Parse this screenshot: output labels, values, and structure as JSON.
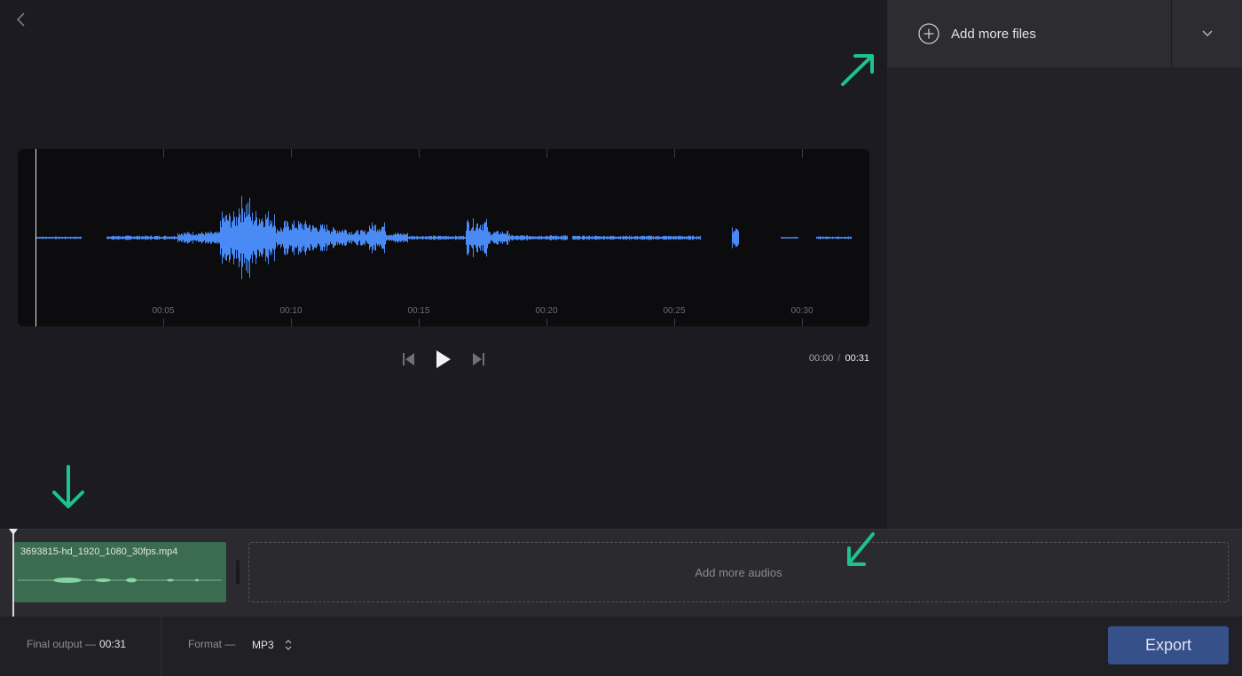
{
  "header": {
    "back_icon": "chevron-left-icon"
  },
  "files_panel": {
    "add_files_label": "Add more files",
    "add_icon": "plus-circle-icon",
    "dropdown_icon": "chevron-down-icon"
  },
  "waveform": {
    "color": "#4a8af4",
    "time_ticks": [
      "00:05",
      "00:10",
      "00:15",
      "00:20",
      "00:25",
      "00:30"
    ]
  },
  "player": {
    "prev_icon": "skip-previous-icon",
    "play_icon": "play-icon",
    "next_icon": "skip-next-icon",
    "current_time": "00:00",
    "separator": "/",
    "total_time": "00:31"
  },
  "timeline": {
    "clip_name": "3693815-hd_1920_1080_30fps.mp4",
    "clip_color": "#3b6b50",
    "add_audios_label": "Add more audios"
  },
  "bottom_bar": {
    "final_output_label": "Final output —",
    "final_output_value": "00:31",
    "format_label": "Format —",
    "format_value": "MP3",
    "export_label": "Export"
  },
  "colors": {
    "accent": "#36508a",
    "hint_arrow": "#1ec28b",
    "waveform": "#4a8af4"
  }
}
